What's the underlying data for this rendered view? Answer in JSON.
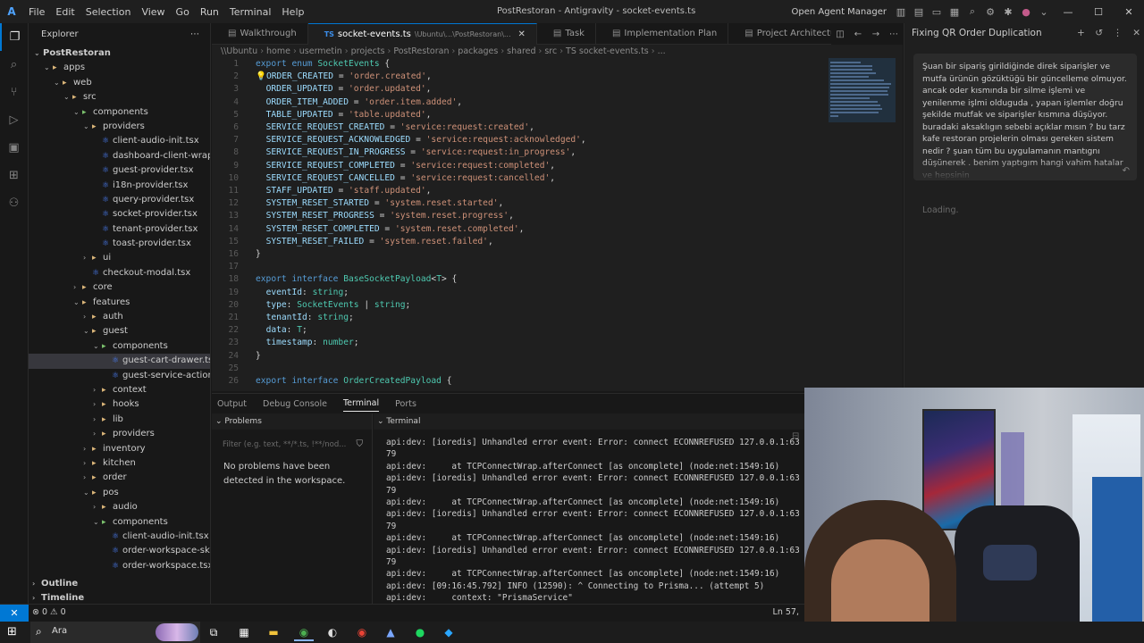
{
  "app": {
    "logo": "A",
    "window_title": "PostRestoran - Antigravity - socket-events.ts"
  },
  "menu": [
    "File",
    "Edit",
    "Selection",
    "View",
    "Go",
    "Run",
    "Terminal",
    "Help"
  ],
  "titlebar_right": {
    "agent_manager": "Open Agent Manager"
  },
  "explorer": {
    "title": "Explorer",
    "tree": [
      {
        "label": "PostRestoran",
        "depth": 0,
        "kind": "root",
        "chevron": "down"
      },
      {
        "label": "apps",
        "depth": 1,
        "kind": "folder",
        "chevron": "down"
      },
      {
        "label": "web",
        "depth": 2,
        "kind": "folder",
        "chevron": "down"
      },
      {
        "label": "src",
        "depth": 3,
        "kind": "folder",
        "chevron": "down"
      },
      {
        "label": "components",
        "depth": 4,
        "kind": "green",
        "chevron": "down"
      },
      {
        "label": "providers",
        "depth": 5,
        "kind": "folder",
        "chevron": "down"
      },
      {
        "label": "client-audio-init.tsx",
        "depth": 6,
        "kind": "tsx"
      },
      {
        "label": "dashboard-client-wrapper.tsx",
        "depth": 6,
        "kind": "tsx"
      },
      {
        "label": "guest-provider.tsx",
        "depth": 6,
        "kind": "tsx"
      },
      {
        "label": "i18n-provider.tsx",
        "depth": 6,
        "kind": "tsx"
      },
      {
        "label": "query-provider.tsx",
        "depth": 6,
        "kind": "tsx"
      },
      {
        "label": "socket-provider.tsx",
        "depth": 6,
        "kind": "tsx"
      },
      {
        "label": "tenant-provider.tsx",
        "depth": 6,
        "kind": "tsx"
      },
      {
        "label": "toast-provider.tsx",
        "depth": 6,
        "kind": "tsx"
      },
      {
        "label": "ui",
        "depth": 5,
        "kind": "folder",
        "chevron": "right"
      },
      {
        "label": "checkout-modal.tsx",
        "depth": 5,
        "kind": "tsx"
      },
      {
        "label": "core",
        "depth": 4,
        "kind": "folder",
        "chevron": "right"
      },
      {
        "label": "features",
        "depth": 4,
        "kind": "folder",
        "chevron": "down"
      },
      {
        "label": "auth",
        "depth": 5,
        "kind": "folder",
        "chevron": "right"
      },
      {
        "label": "guest",
        "depth": 5,
        "kind": "folder",
        "chevron": "down"
      },
      {
        "label": "components",
        "depth": 6,
        "kind": "green",
        "chevron": "down"
      },
      {
        "label": "guest-cart-drawer.tsx",
        "depth": 7,
        "kind": "tsx",
        "selected": true
      },
      {
        "label": "guest-service-action-menu.t...",
        "depth": 7,
        "kind": "tsx"
      },
      {
        "label": "context",
        "depth": 6,
        "kind": "folder",
        "chevron": "right"
      },
      {
        "label": "hooks",
        "depth": 6,
        "kind": "folder",
        "chevron": "right"
      },
      {
        "label": "lib",
        "depth": 6,
        "kind": "folder",
        "chevron": "right"
      },
      {
        "label": "providers",
        "depth": 6,
        "kind": "folder",
        "chevron": "right"
      },
      {
        "label": "inventory",
        "depth": 5,
        "kind": "folder",
        "chevron": "right"
      },
      {
        "label": "kitchen",
        "depth": 5,
        "kind": "folder",
        "chevron": "right"
      },
      {
        "label": "order",
        "depth": 5,
        "kind": "folder",
        "chevron": "right"
      },
      {
        "label": "pos",
        "depth": 5,
        "kind": "folder",
        "chevron": "down"
      },
      {
        "label": "audio",
        "depth": 6,
        "kind": "folder",
        "chevron": "right"
      },
      {
        "label": "components",
        "depth": 6,
        "kind": "green",
        "chevron": "down"
      },
      {
        "label": "client-audio-init.tsx",
        "depth": 7,
        "kind": "tsx"
      },
      {
        "label": "order-workspace-skeleton.tsx",
        "depth": 7,
        "kind": "tsx"
      },
      {
        "label": "order-workspace.tsx",
        "depth": 7,
        "kind": "tsx"
      }
    ],
    "outline": "Outline",
    "timeline": "Timeline"
  },
  "tabs": [
    {
      "label": "Walkthrough",
      "icon": "doc-icon"
    },
    {
      "label": "socket-events.ts",
      "sub": "\\Ubuntu\\...\\PostRestoran\\...",
      "icon": "ts",
      "active": true
    },
    {
      "label": "Task",
      "icon": "doc-icon"
    },
    {
      "label": "Implementation Plan",
      "icon": "doc-icon"
    },
    {
      "label": "Project Architecture Repo",
      "icon": "doc-icon"
    }
  ],
  "breadcrumb": [
    "\\\\Ubuntu",
    "home",
    "usermetin",
    "projects",
    "PostRestoran",
    "packages",
    "shared",
    "src",
    "TS socket-events.ts",
    "..."
  ],
  "code_lines": [
    {
      "n": "1",
      "t": [
        [
          "kw",
          "export "
        ],
        [
          "kw",
          "enum "
        ],
        [
          "ty",
          "SocketEvents "
        ],
        [
          "pu",
          "{"
        ]
      ]
    },
    {
      "n": "2",
      "t": [
        [
          "fn",
          "💡"
        ],
        [
          "en",
          "ORDER_CREATED "
        ],
        [
          "pu",
          "= "
        ],
        [
          "st",
          "'order.created'"
        ],
        [
          "pu",
          ","
        ]
      ]
    },
    {
      "n": "3",
      "t": [
        [
          "pu",
          "  "
        ],
        [
          "en",
          "ORDER_UPDATED "
        ],
        [
          "pu",
          "= "
        ],
        [
          "st",
          "'order.updated'"
        ],
        [
          "pu",
          ","
        ]
      ]
    },
    {
      "n": "4",
      "t": [
        [
          "pu",
          "  "
        ],
        [
          "en",
          "ORDER_ITEM_ADDED "
        ],
        [
          "pu",
          "= "
        ],
        [
          "st",
          "'order.item.added'"
        ],
        [
          "pu",
          ","
        ]
      ]
    },
    {
      "n": "5",
      "t": [
        [
          "pu",
          "  "
        ],
        [
          "en",
          "TABLE_UPDATED "
        ],
        [
          "pu",
          "= "
        ],
        [
          "st",
          "'table.updated'"
        ],
        [
          "pu",
          ","
        ]
      ]
    },
    {
      "n": "6",
      "t": [
        [
          "pu",
          "  "
        ],
        [
          "en",
          "SERVICE_REQUEST_CREATED "
        ],
        [
          "pu",
          "= "
        ],
        [
          "st",
          "'service:request:created'"
        ],
        [
          "pu",
          ","
        ]
      ]
    },
    {
      "n": "7",
      "t": [
        [
          "pu",
          "  "
        ],
        [
          "en",
          "SERVICE_REQUEST_ACKNOWLEDGED "
        ],
        [
          "pu",
          "= "
        ],
        [
          "st",
          "'service:request:acknowledged'"
        ],
        [
          "pu",
          ","
        ]
      ]
    },
    {
      "n": "8",
      "t": [
        [
          "pu",
          "  "
        ],
        [
          "en",
          "SERVICE_REQUEST_IN_PROGRESS "
        ],
        [
          "pu",
          "= "
        ],
        [
          "st",
          "'service:request:in_progress'"
        ],
        [
          "pu",
          ","
        ]
      ]
    },
    {
      "n": "9",
      "t": [
        [
          "pu",
          "  "
        ],
        [
          "en",
          "SERVICE_REQUEST_COMPLETED "
        ],
        [
          "pu",
          "= "
        ],
        [
          "st",
          "'service:request:completed'"
        ],
        [
          "pu",
          ","
        ]
      ]
    },
    {
      "n": "10",
      "t": [
        [
          "pu",
          "  "
        ],
        [
          "en",
          "SERVICE_REQUEST_CANCELLED "
        ],
        [
          "pu",
          "= "
        ],
        [
          "st",
          "'service:request:cancelled'"
        ],
        [
          "pu",
          ","
        ]
      ]
    },
    {
      "n": "11",
      "t": [
        [
          "pu",
          "  "
        ],
        [
          "en",
          "STAFF_UPDATED "
        ],
        [
          "pu",
          "= "
        ],
        [
          "st",
          "'staff.updated'"
        ],
        [
          "pu",
          ","
        ]
      ]
    },
    {
      "n": "12",
      "t": [
        [
          "pu",
          "  "
        ],
        [
          "en",
          "SYSTEM_RESET_STARTED "
        ],
        [
          "pu",
          "= "
        ],
        [
          "st",
          "'system.reset.started'"
        ],
        [
          "pu",
          ","
        ]
      ]
    },
    {
      "n": "13",
      "t": [
        [
          "pu",
          "  "
        ],
        [
          "en",
          "SYSTEM_RESET_PROGRESS "
        ],
        [
          "pu",
          "= "
        ],
        [
          "st",
          "'system.reset.progress'"
        ],
        [
          "pu",
          ","
        ]
      ]
    },
    {
      "n": "14",
      "t": [
        [
          "pu",
          "  "
        ],
        [
          "en",
          "SYSTEM_RESET_COMPLETED "
        ],
        [
          "pu",
          "= "
        ],
        [
          "st",
          "'system.reset.completed'"
        ],
        [
          "pu",
          ","
        ]
      ]
    },
    {
      "n": "15",
      "t": [
        [
          "pu",
          "  "
        ],
        [
          "en",
          "SYSTEM_RESET_FAILED "
        ],
        [
          "pu",
          "= "
        ],
        [
          "st",
          "'system.reset.failed'"
        ],
        [
          "pu",
          ","
        ]
      ]
    },
    {
      "n": "16",
      "t": [
        [
          "pu",
          "}"
        ]
      ]
    },
    {
      "n": "17",
      "t": []
    },
    {
      "n": "18",
      "t": [
        [
          "kw",
          "export "
        ],
        [
          "kw",
          "interface "
        ],
        [
          "ty",
          "BaseSocketPayload"
        ],
        [
          "pu",
          "<"
        ],
        [
          "ty",
          "T"
        ],
        [
          "pu",
          "> {"
        ]
      ]
    },
    {
      "n": "19",
      "t": [
        [
          "pu",
          "  "
        ],
        [
          "pr",
          "eventId"
        ],
        [
          "pu",
          ": "
        ],
        [
          "ty",
          "string"
        ],
        [
          "pu",
          ";"
        ]
      ]
    },
    {
      "n": "20",
      "t": [
        [
          "pu",
          "  "
        ],
        [
          "pr",
          "type"
        ],
        [
          "pu",
          ": "
        ],
        [
          "ty",
          "SocketEvents "
        ],
        [
          "pu",
          "| "
        ],
        [
          "ty",
          "string"
        ],
        [
          "pu",
          ";"
        ]
      ]
    },
    {
      "n": "21",
      "t": [
        [
          "pu",
          "  "
        ],
        [
          "pr",
          "tenantId"
        ],
        [
          "pu",
          ": "
        ],
        [
          "ty",
          "string"
        ],
        [
          "pu",
          ";"
        ]
      ]
    },
    {
      "n": "22",
      "t": [
        [
          "pu",
          "  "
        ],
        [
          "pr",
          "data"
        ],
        [
          "pu",
          ": "
        ],
        [
          "ty",
          "T"
        ],
        [
          "pu",
          ";"
        ]
      ]
    },
    {
      "n": "23",
      "t": [
        [
          "pu",
          "  "
        ],
        [
          "pr",
          "timestamp"
        ],
        [
          "pu",
          ": "
        ],
        [
          "ty",
          "number"
        ],
        [
          "pu",
          ";"
        ]
      ]
    },
    {
      "n": "24",
      "t": [
        [
          "pu",
          "}"
        ]
      ]
    },
    {
      "n": "25",
      "t": []
    },
    {
      "n": "26",
      "t": [
        [
          "kw",
          "export "
        ],
        [
          "kw",
          "interface "
        ],
        [
          "ty",
          "OrderCreatedPayload "
        ],
        [
          "pu",
          "{"
        ]
      ]
    }
  ],
  "panel": {
    "tabs": [
      "Output",
      "Debug Console",
      "Terminal",
      "Ports"
    ],
    "active_tab": "Terminal",
    "problems_title": "Problems",
    "filter_placeholder": "Filter (e.g. text, **/*.ts, !**/nod...",
    "no_problems": "No problems have been detected in the workspace.",
    "terminal_title": "Terminal",
    "terminal_lines": [
      "api:dev: [ioredis] Unhandled error event: Error: connect ECONNREFUSED 127.0.0.1:63",
      "79",
      "api:dev:     at TCPConnectWrap.afterConnect [as oncomplete] (node:net:1549:16)",
      "api:dev: [ioredis] Unhandled error event: Error: connect ECONNREFUSED 127.0.0.1:63",
      "79",
      "api:dev:     at TCPConnectWrap.afterConnect [as oncomplete] (node:net:1549:16)",
      "api:dev: [ioredis] Unhandled error event: Error: connect ECONNREFUSED 127.0.0.1:63",
      "79",
      "api:dev:     at TCPConnectWrap.afterConnect [as oncomplete] (node:net:1549:16)",
      "api:dev: [ioredis] Unhandled error event: Error: connect ECONNREFUSED 127.0.0.1:63",
      "79",
      "api:dev:     at TCPConnectWrap.afterConnect [as oncomplete] (node:net:1549:16)",
      "api:dev: [09:16:45.792] INFO (12590): ^ Connecting to Prisma... (attempt 5)",
      "api:dev:     context: \"PrismaService\""
    ]
  },
  "chat": {
    "title": "Fixing QR Order Duplication",
    "message": "Şuan bir sipariş girildiğinde direk  siparişler ve mutfa  ürünün gözüktüğü bir güncelleme olmuyor. ancak    oder kısmında bir  silme işlemi ve yenilenme işlmi olduguda  ,  yapan işlemler doğru şekilde  mutfak  ve siparişler kısmına düşüyor. buradaki aksaklıgın sebebi açıklar mısın ?  bu tarz  kafe restoran projelerin olması gereken sistem nedir ?   şuan tüm bu uygulamanın mantıgnı düşünerek . benim yaptıgım hangi vahim hatalar ve hepsinin",
    "loading": "Loading."
  },
  "statusbar": {
    "errors": "0",
    "warnings": "0",
    "position": "Ln 57,"
  },
  "taskbar": {
    "search_text": "Ara"
  }
}
